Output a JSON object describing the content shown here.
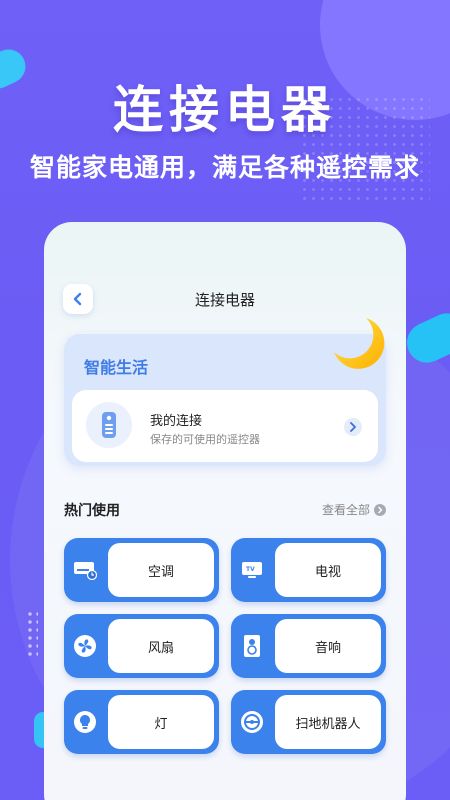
{
  "hero": {
    "title": "连接电器",
    "subtitle": "智能家电通用，满足各种遥控需求"
  },
  "app": {
    "page_title": "连接电器",
    "smart_section": {
      "title": "智能生活",
      "connection": {
        "title": "我的连接",
        "subtitle": "保存的可使用的遥控器"
      }
    },
    "hot": {
      "title": "热门使用",
      "see_all": "查看全部",
      "items": [
        {
          "label": "空调",
          "icon": "air-conditioner-icon"
        },
        {
          "label": "电视",
          "icon": "tv-icon"
        },
        {
          "label": "风扇",
          "icon": "fan-icon"
        },
        {
          "label": "音响",
          "icon": "speaker-icon"
        },
        {
          "label": "灯",
          "icon": "light-bulb-icon"
        },
        {
          "label": "扫地机器人",
          "icon": "robot-vacuum-icon"
        }
      ]
    }
  },
  "colors": {
    "background": "#6a5cf5",
    "accent_blue": "#3b82ec",
    "cyan": "#27c2f5",
    "moon": "#ffc21a"
  }
}
